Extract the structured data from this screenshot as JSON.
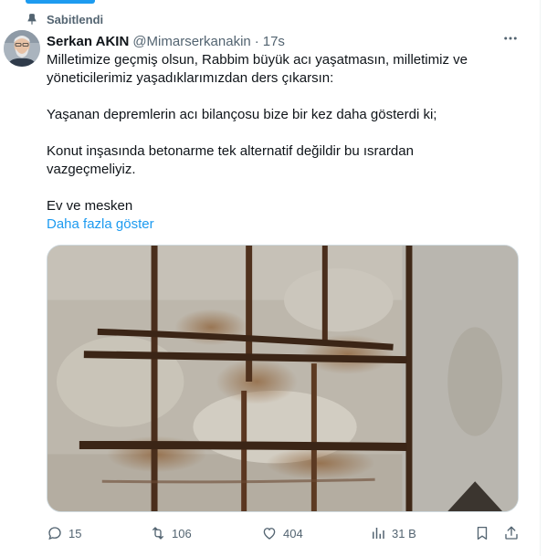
{
  "pinned": {
    "icon": "pin-icon",
    "label": "Sabitlendi"
  },
  "author": {
    "avatar_icon": "avatar",
    "name": "Serkan AKIN",
    "handle": "@Mimarserkanakin",
    "separator": "·",
    "time": "17s"
  },
  "menu": {
    "icon": "more-icon"
  },
  "tweet": {
    "paragraphs": [
      "Milletimize geçmiş olsun, Rabbim büyük acı yaşatmasın, milletimiz ve yöneticilerimiz yaşadıklarımızdan ders çıkarsın:",
      "Yaşanan depremlerin acı bilançosu bize bir kez daha gösterdi ki;",
      "Konut inşasında betonarme tek alternatif değildir bu ısrardan vazgeçmeliyiz.",
      "Ev ve mesken"
    ],
    "show_more": "Daha fazla göster"
  },
  "actions": {
    "reply": {
      "icon": "reply-icon",
      "count": "15"
    },
    "retweet": {
      "icon": "retweet-icon",
      "count": "106"
    },
    "like": {
      "icon": "heart-icon",
      "count": "404"
    },
    "views": {
      "icon": "views-icon",
      "count": "31 B"
    },
    "bookmark": {
      "icon": "bookmark-icon"
    },
    "share": {
      "icon": "share-icon"
    }
  },
  "colors": {
    "accent": "#1d9bf0",
    "text_primary": "#0f1419",
    "text_secondary": "#536471",
    "border": "#cfd9de"
  }
}
